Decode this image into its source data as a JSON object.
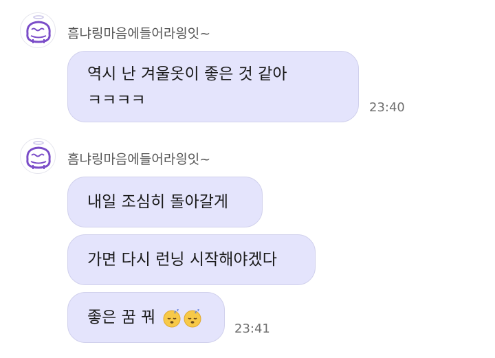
{
  "chat": {
    "groups": [
      {
        "sender": "흠냐링마음에들어라읭잇~",
        "messages": [
          {
            "line1": "역시 난 겨울옷이 좋은 것 같아",
            "line2": "ㅋㅋㅋㅋ"
          }
        ],
        "time": "23:40"
      },
      {
        "sender": "흠냐링마음에들어라읭잇~",
        "messages": [
          {
            "text": "내일 조심히 돌아갈게"
          },
          {
            "text": "가면 다시 런닝 시작해야겠다"
          },
          {
            "text": "좋은 꿈 꿔",
            "emoji": "sleeping-face-icon sleeping-face-icon"
          }
        ],
        "time": "23:41"
      }
    ]
  },
  "colors": {
    "bubble_bg": "#e4e4fc",
    "bubble_border": "#d0d0ec",
    "avatar_accent": "#7a4cc8"
  }
}
